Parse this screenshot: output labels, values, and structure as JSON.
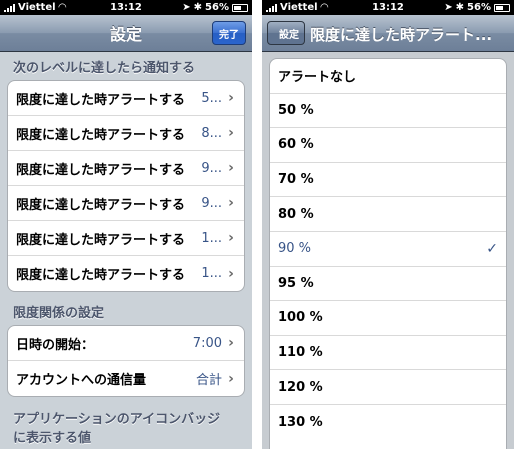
{
  "status_bar": {
    "carrier": "Viettel",
    "time": "13:12",
    "battery": "56%"
  },
  "left_screen": {
    "nav": {
      "title": "設定",
      "done_label": "完了"
    },
    "section1": {
      "header": "次のレベルに達したら通知する",
      "rows": [
        {
          "label": "限度に達した時アラートする",
          "value": "5..."
        },
        {
          "label": "限度に達した時アラートする",
          "value": "8..."
        },
        {
          "label": "限度に達した時アラートする",
          "value": "9..."
        },
        {
          "label": "限度に達した時アラートする",
          "value": "9..."
        },
        {
          "label": "限度に達した時アラートする",
          "value": "1..."
        },
        {
          "label": "限度に達した時アラートする",
          "value": "1..."
        }
      ]
    },
    "section2": {
      "header": "限度関係の設定",
      "rows": [
        {
          "label": "日時の開始：",
          "value": "7:00"
        },
        {
          "label": "アカウントへの通信量",
          "value": "合計"
        }
      ]
    },
    "section3": {
      "header_line1": "アプリケーションのアイコンバッジ",
      "header_line2": "に表示する値"
    }
  },
  "right_screen": {
    "nav": {
      "back_label": "設定",
      "title": "限度に達した時アラート..."
    },
    "options": [
      {
        "label": "アラートなし"
      },
      {
        "label": "50 %"
      },
      {
        "label": "60 %"
      },
      {
        "label": "70 %"
      },
      {
        "label": "80 %"
      },
      {
        "label": "90 %",
        "selected": true
      },
      {
        "label": "95 %"
      },
      {
        "label": "100 %"
      },
      {
        "label": "110 %"
      },
      {
        "label": "120 %"
      },
      {
        "label": "130 %"
      }
    ],
    "check_mark": "✓"
  }
}
